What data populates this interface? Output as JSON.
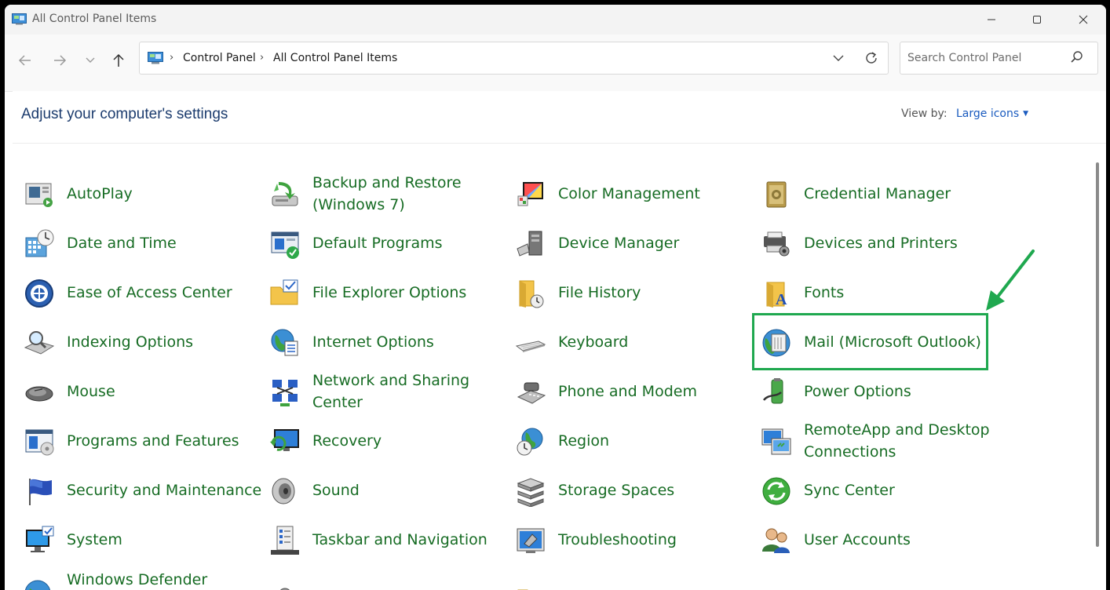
{
  "window": {
    "title": "All Control Panel Items",
    "controls": [
      "minimize-icon",
      "maximize-icon",
      "close-icon"
    ]
  },
  "toolbar": {
    "nav": [
      "back-arrow-icon",
      "forward-arrow-icon",
      "recent-chevron-icon",
      "up-arrow-icon"
    ],
    "breadcrumb": [
      "Control Panel",
      "All Control Panel Items"
    ],
    "search_placeholder": "Search Control Panel"
  },
  "header": {
    "title": "Adjust your computer's settings",
    "view_by_label": "View by:",
    "view_by_value": "Large icons"
  },
  "items": [
    {
      "label": "AutoPlay",
      "icon": "autoplay-icon"
    },
    {
      "label": "Backup and Restore (Windows 7)",
      "icon": "backup-restore-icon"
    },
    {
      "label": "Color Management",
      "icon": "color-management-icon"
    },
    {
      "label": "Credential Manager",
      "icon": "credential-manager-icon"
    },
    {
      "label": "Date and Time",
      "icon": "date-time-icon"
    },
    {
      "label": "Default Programs",
      "icon": "default-programs-icon"
    },
    {
      "label": "Device Manager",
      "icon": "device-manager-icon"
    },
    {
      "label": "Devices and Printers",
      "icon": "devices-printers-icon"
    },
    {
      "label": "Ease of Access Center",
      "icon": "ease-of-access-icon"
    },
    {
      "label": "File Explorer Options",
      "icon": "file-explorer-options-icon"
    },
    {
      "label": "File History",
      "icon": "file-history-icon"
    },
    {
      "label": "Fonts",
      "icon": "fonts-icon"
    },
    {
      "label": "Indexing Options",
      "icon": "indexing-options-icon"
    },
    {
      "label": "Internet Options",
      "icon": "internet-options-icon"
    },
    {
      "label": "Keyboard",
      "icon": "keyboard-icon"
    },
    {
      "label": "Mail (Microsoft Outlook)",
      "icon": "mail-icon"
    },
    {
      "label": "Mouse",
      "icon": "mouse-icon"
    },
    {
      "label": "Network and Sharing Center",
      "icon": "network-sharing-icon"
    },
    {
      "label": "Phone and Modem",
      "icon": "phone-modem-icon"
    },
    {
      "label": "Power Options",
      "icon": "power-options-icon"
    },
    {
      "label": "Programs and Features",
      "icon": "programs-features-icon"
    },
    {
      "label": "Recovery",
      "icon": "recovery-icon"
    },
    {
      "label": "Region",
      "icon": "region-icon"
    },
    {
      "label": "RemoteApp and Desktop Connections",
      "icon": "remoteapp-icon"
    },
    {
      "label": "Security and Maintenance",
      "icon": "security-maintenance-icon"
    },
    {
      "label": "Sound",
      "icon": "sound-icon"
    },
    {
      "label": "Storage Spaces",
      "icon": "storage-spaces-icon"
    },
    {
      "label": "Sync Center",
      "icon": "sync-center-icon"
    },
    {
      "label": "System",
      "icon": "system-icon"
    },
    {
      "label": "Taskbar and Navigation",
      "icon": "taskbar-navigation-icon"
    },
    {
      "label": "Troubleshooting",
      "icon": "troubleshooting-icon"
    },
    {
      "label": "User Accounts",
      "icon": "user-accounts-icon"
    },
    {
      "label": "Windows Defender",
      "icon": "windows-defender-icon"
    }
  ],
  "annotation": {
    "highlighted_item": "Mail (Microsoft Outlook)",
    "color": "#1fa84f"
  },
  "colors": {
    "item_label": "#176c24",
    "header_title": "#1c3c6e",
    "link": "#1a5bbf"
  }
}
